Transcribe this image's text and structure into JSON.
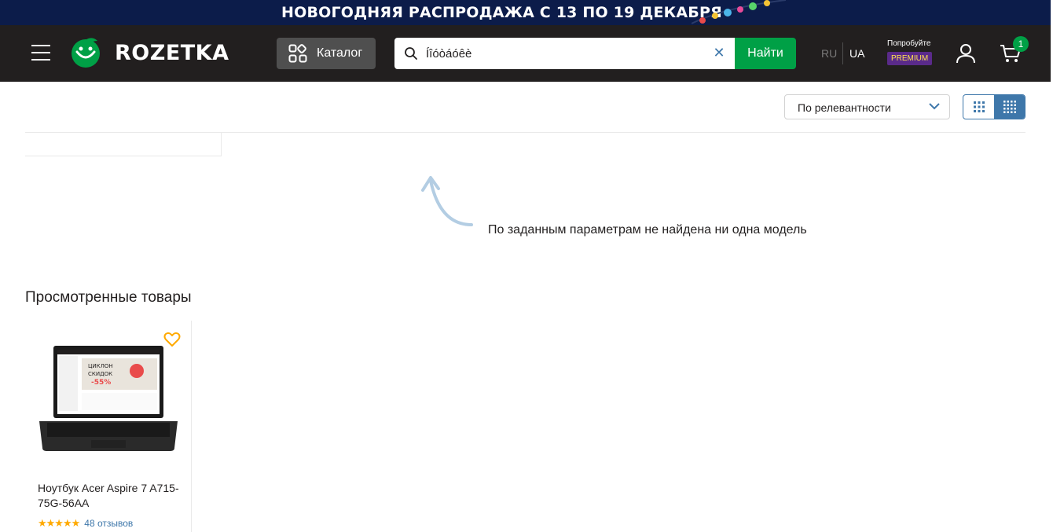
{
  "banner": {
    "text": "НОВОГОДНЯЯ РАСПРОДАЖА С 13 ПО 19 ДЕКАБРЯ"
  },
  "header": {
    "logo_text": "ROZETKA",
    "catalog_label": "Каталог",
    "search": {
      "value": "Íîóòáóêè",
      "placeholder": ""
    },
    "find_label": "Найти",
    "lang": {
      "ru": "RU",
      "ua": "UA",
      "active": "UA"
    },
    "premium": {
      "top": "Попробуйте",
      "badge": "PREMIUM"
    },
    "cart_count": "1"
  },
  "toolbar": {
    "sort_selected": "По релевантности",
    "view_modes": [
      "large-tiles",
      "small-tiles"
    ],
    "active_view": "small-tiles"
  },
  "results": {
    "empty_message": "По заданным параметрам не найдена ни одна модель"
  },
  "viewed": {
    "title": "Просмотренные товары",
    "items": [
      {
        "title": "Ноутбук Acer Aspire 7 A715-75G-56AA",
        "rating_stars": 4.5,
        "reviews": "48 отзывов",
        "screen_text": [
          "ЦИКЛОН",
          "СКИДОК",
          "-55%"
        ]
      }
    ]
  },
  "colors": {
    "brand_green": "#00a046",
    "header_bg": "#221f1f",
    "link_blue": "#3e77aa",
    "banner_bg": "#0c1c4a",
    "star": "#ffa900"
  }
}
